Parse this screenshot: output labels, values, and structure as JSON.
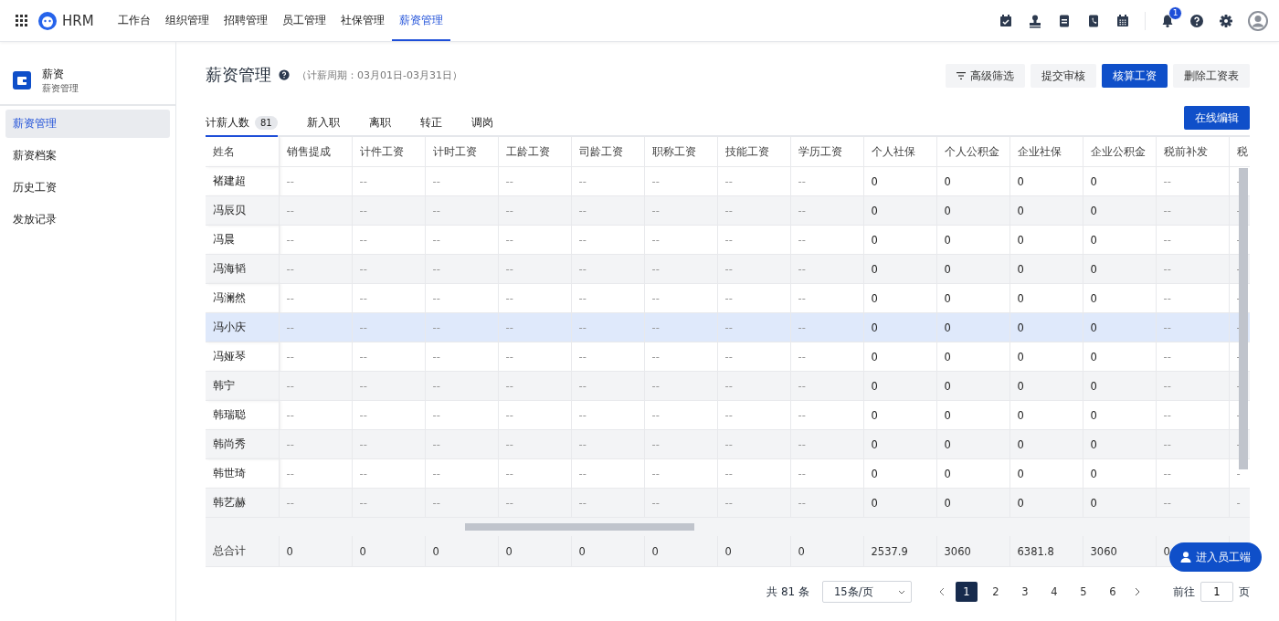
{
  "app": {
    "name": "HRM"
  },
  "nav": [
    {
      "label": "工作台",
      "selected": false
    },
    {
      "label": "组织管理",
      "selected": false
    },
    {
      "label": "招聘管理",
      "selected": false
    },
    {
      "label": "员工管理",
      "selected": false
    },
    {
      "label": "社保管理",
      "selected": false
    },
    {
      "label": "薪资管理",
      "selected": true
    }
  ],
  "notifications": {
    "count": "1"
  },
  "sidebar": {
    "title": "薪资",
    "subtitle": "薪资管理",
    "items": [
      {
        "label": "薪资管理",
        "selected": true
      },
      {
        "label": "薪资档案",
        "selected": false
      },
      {
        "label": "历史工资",
        "selected": false
      },
      {
        "label": "发放记录",
        "selected": false
      }
    ]
  },
  "page": {
    "title": "薪资管理",
    "period": "（计薪周期：03月01日-03月31日）"
  },
  "actions": [
    {
      "label": "高级筛选",
      "kind": "filter"
    },
    {
      "label": "提交审核",
      "kind": "secondary"
    },
    {
      "label": "核算工资",
      "kind": "primary"
    },
    {
      "label": "删除工资表",
      "kind": "secondary"
    }
  ],
  "tabs": [
    {
      "label": "计薪人数",
      "count": "81",
      "selected": true
    },
    {
      "label": "新入职",
      "selected": false
    },
    {
      "label": "离职",
      "selected": false
    },
    {
      "label": "转正",
      "selected": false
    },
    {
      "label": "调岗",
      "selected": false
    }
  ],
  "edit_button": "在线编辑",
  "table": {
    "columns": [
      "姓名",
      "销售提成",
      "计件工资",
      "计时工资",
      "工龄工资",
      "司龄工资",
      "职称工资",
      "技能工资",
      "学历工资",
      "个人社保",
      "个人公积金",
      "企业社保",
      "企业公积金",
      "税前补发",
      "税"
    ],
    "rows": [
      {
        "selected": false,
        "cells": [
          "褚建超",
          "--",
          "--",
          "--",
          "--",
          "--",
          "--",
          "--",
          "--",
          "0",
          "0",
          "0",
          "0",
          "--",
          "-"
        ]
      },
      {
        "selected": false,
        "cells": [
          "冯辰贝",
          "--",
          "--",
          "--",
          "--",
          "--",
          "--",
          "--",
          "--",
          "0",
          "0",
          "0",
          "0",
          "--",
          "-"
        ]
      },
      {
        "selected": false,
        "cells": [
          "冯晨",
          "--",
          "--",
          "--",
          "--",
          "--",
          "--",
          "--",
          "--",
          "0",
          "0",
          "0",
          "0",
          "--",
          "-"
        ]
      },
      {
        "selected": false,
        "cells": [
          "冯海韬",
          "--",
          "--",
          "--",
          "--",
          "--",
          "--",
          "--",
          "--",
          "0",
          "0",
          "0",
          "0",
          "--",
          "-"
        ]
      },
      {
        "selected": false,
        "cells": [
          "冯澜然",
          "--",
          "--",
          "--",
          "--",
          "--",
          "--",
          "--",
          "--",
          "0",
          "0",
          "0",
          "0",
          "--",
          "-"
        ]
      },
      {
        "selected": true,
        "cells": [
          "冯小庆",
          "--",
          "--",
          "--",
          "--",
          "--",
          "--",
          "--",
          "--",
          "0",
          "0",
          "0",
          "0",
          "--",
          "-"
        ]
      },
      {
        "selected": false,
        "cells": [
          "冯娅琴",
          "--",
          "--",
          "--",
          "--",
          "--",
          "--",
          "--",
          "--",
          "0",
          "0",
          "0",
          "0",
          "--",
          "-"
        ]
      },
      {
        "selected": false,
        "cells": [
          "韩宁",
          "--",
          "--",
          "--",
          "--",
          "--",
          "--",
          "--",
          "--",
          "0",
          "0",
          "0",
          "0",
          "--",
          "-"
        ]
      },
      {
        "selected": false,
        "cells": [
          "韩瑞聪",
          "--",
          "--",
          "--",
          "--",
          "--",
          "--",
          "--",
          "--",
          "0",
          "0",
          "0",
          "0",
          "--",
          "-"
        ]
      },
      {
        "selected": false,
        "cells": [
          "韩尚秀",
          "--",
          "--",
          "--",
          "--",
          "--",
          "--",
          "--",
          "--",
          "0",
          "0",
          "0",
          "0",
          "--",
          "-"
        ]
      },
      {
        "selected": false,
        "cells": [
          "韩世琦",
          "--",
          "--",
          "--",
          "--",
          "--",
          "--",
          "--",
          "--",
          "0",
          "0",
          "0",
          "0",
          "--",
          "-"
        ]
      },
      {
        "selected": false,
        "cells": [
          "韩艺赫",
          "--",
          "--",
          "--",
          "--",
          "--",
          "--",
          "--",
          "--",
          "0",
          "0",
          "0",
          "0",
          "--",
          "-"
        ]
      }
    ],
    "total": {
      "cells": [
        "总合计",
        "0",
        "0",
        "0",
        "0",
        "0",
        "0",
        "0",
        "0",
        "2537.9",
        "3060",
        "6381.8",
        "3060",
        "0"
      ]
    }
  },
  "pagination": {
    "total": "共 81 条",
    "page_size": "15条/页",
    "pages": [
      {
        "label": "1",
        "selected": true
      },
      {
        "label": "2",
        "selected": false
      },
      {
        "label": "3",
        "selected": false
      },
      {
        "label": "4",
        "selected": false
      },
      {
        "label": "5",
        "selected": false
      },
      {
        "label": "6",
        "selected": false
      }
    ],
    "goto_label": "前往",
    "goto_value": "1",
    "page_suffix": "页"
  },
  "floating_button": "进入员工端"
}
